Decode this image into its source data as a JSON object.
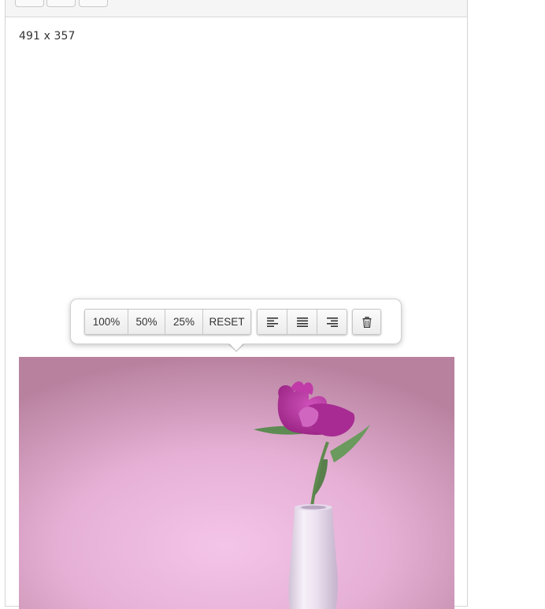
{
  "editor": {
    "image_size_label": "491 x 357"
  },
  "image_popover": {
    "resize_buttons": [
      {
        "label": "100%"
      },
      {
        "label": "50%"
      },
      {
        "label": "25%"
      },
      {
        "label": "RESET"
      }
    ],
    "align_buttons": [
      {
        "icon": "align-left-icon"
      },
      {
        "icon": "align-justify-icon"
      },
      {
        "icon": "align-right-icon"
      }
    ],
    "remove_button": {
      "icon": "trash-icon"
    }
  },
  "image": {
    "subject": "pink-peony-in-white-vase",
    "background_color": "#efbde2",
    "flower_color": "#b2369f",
    "vase_color": "#ede4f1"
  }
}
